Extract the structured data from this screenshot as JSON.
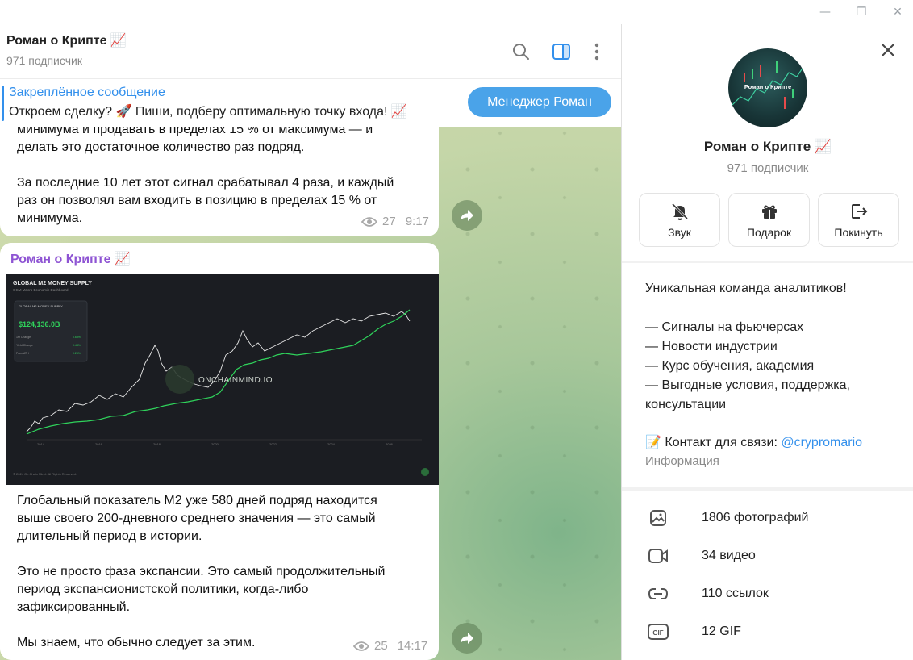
{
  "window": {
    "minimize": "—",
    "restore": "❐",
    "close": "✕"
  },
  "header": {
    "title": "Роман о Крипте 📈",
    "subscribers": "971 подписчик"
  },
  "pinned": {
    "title": "Закреплённое сообщение",
    "text": "Откроем сделку? 🚀  Пиши, подберу оптимальную точку входа! 📈",
    "button": "Менеджер Роман"
  },
  "messages": [
    {
      "text": "минимума и продавать в пределах 15 % от максимума — и\nделать это достаточное количество раз подряд.\n\nЗа последние 10 лет этот сигнал срабатывал 4 раза, и каждый\nраз он позволял вам входить в позицию в пределах 15 % от\nминимума.",
      "views": "27",
      "time": "9:17"
    },
    {
      "sender": "Роман о Крипте 📈",
      "image": {
        "title": "GLOBAL M2 MONEY SUPPLY",
        "subtitle": "OCM Macro Economic Dashboard",
        "card_title": "GLOBAL M2 MONEY SUPPLY",
        "card_value": "$124,136.0B",
        "card_rows": [
          {
            "label": "1M Change",
            "value": "0.68%"
          },
          {
            "label": "Yield Change",
            "value": "0.44%"
          },
          {
            "label": "From ATH",
            "value": "0.26%"
          }
        ],
        "watermark": "ONCHAINMIND.IO",
        "copyright": "© 2024 On Chain Mind. All Rights Reserved.",
        "x_ticks": [
          "2014",
          "2016",
          "2018",
          "2020",
          "2022",
          "2024",
          "2026"
        ]
      },
      "text": "Глобальный показатель М2 уже 580 дней подряд находится\nвыше своего 200-дневного среднего значения — это самый\nдлительный период в истории.\n\nЭто не просто фаза экспансии. Это самый продолжительный\nпериод экспансионистской политики, когда-либо\nзафиксированный.\n\nМы знаем, что обычно следует за этим.",
      "views": "25",
      "time": "14:17"
    }
  ],
  "profile": {
    "avatar_text": "Роман о Крипте",
    "name": "Роман о Крипте 📈",
    "subscribers": "971 подписчик",
    "actions": [
      {
        "label": "Звук",
        "icon": "bell-off-icon"
      },
      {
        "label": "Подарок",
        "icon": "gift-icon"
      },
      {
        "label": "Покинуть",
        "icon": "leave-icon"
      }
    ],
    "about": "Уникальная команда аналитиков!\n\n— Сигналы на фьючерсах\n— Новости индустрии\n— Курс обучения, академия\n— Выгодные условия, поддержка,\nконсультации",
    "contact_prefix": "📝 Контакт для связи: ",
    "contact_link": "@crypromario",
    "info_label": "Информация",
    "media": [
      {
        "label": "1806 фотографий",
        "icon": "photo-icon"
      },
      {
        "label": "34 видео",
        "icon": "video-icon"
      },
      {
        "label": "110 ссылок",
        "icon": "link-icon"
      },
      {
        "label": "12 GIF",
        "icon": "gif-icon"
      }
    ]
  },
  "colors": {
    "accent": "#3390ec",
    "sender": "#8e54d3",
    "button": "#4aa3e9"
  }
}
